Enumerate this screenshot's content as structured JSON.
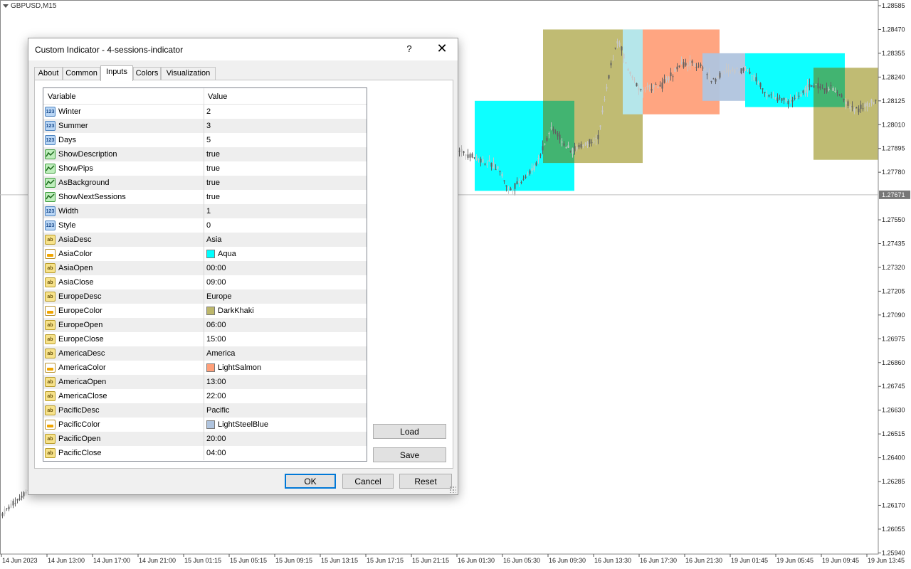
{
  "chart": {
    "title": "GBPUSD,M15",
    "current_price": "1.27671",
    "price_labels": [
      "1.28585",
      "1.28470",
      "1.28355",
      "1.28240",
      "1.28125",
      "1.28010",
      "1.27895",
      "1.27780",
      "1.27671",
      "1.27550",
      "1.27435",
      "1.27320",
      "1.27205",
      "1.27090",
      "1.26975",
      "1.26860",
      "1.26745",
      "1.26630",
      "1.26515",
      "1.26400",
      "1.26285",
      "1.26170",
      "1.26055",
      "1.25940"
    ],
    "time_labels": [
      "14 Jun 2023",
      "14 Jun 13:00",
      "14 Jun 17:00",
      "14 Jun 21:00",
      "15 Jun 01:15",
      "15 Jun 05:15",
      "15 Jun 09:15",
      "15 Jun 13:15",
      "15 Jun 17:15",
      "15 Jun 21:15",
      "16 Jun 01:30",
      "16 Jun 05:30",
      "16 Jun 09:30",
      "16 Jun 13:30",
      "16 Jun 17:30",
      "16 Jun 21:30",
      "19 Jun 01:45",
      "19 Jun 05:45",
      "19 Jun 09:45",
      "19 Jun 13:45"
    ],
    "session_colors": {
      "asia": "#00FFFF",
      "europe": "#BDB76B",
      "america": "#FFA07A",
      "pacific": "#B0C4DE",
      "asia_europe_overlap": "#3CB371",
      "pacific_asia_overlap": "#B4E8F0"
    }
  },
  "dialog": {
    "title": "Custom Indicator - 4-sessions-indicator",
    "help_label": "?",
    "close_label": "✕",
    "tabs": [
      {
        "label": "About",
        "active": false
      },
      {
        "label": "Common",
        "active": false
      },
      {
        "label": "Inputs",
        "active": true
      },
      {
        "label": "Colors",
        "active": false
      },
      {
        "label": "Visualization",
        "active": false
      }
    ],
    "grid": {
      "col_variable": "Variable",
      "col_value": "Value",
      "rows": [
        {
          "type": "int",
          "name": "Winter",
          "value": "2"
        },
        {
          "type": "int",
          "name": "Summer",
          "value": "3"
        },
        {
          "type": "int",
          "name": "Days",
          "value": "5"
        },
        {
          "type": "bool",
          "name": "ShowDescription",
          "value": "true"
        },
        {
          "type": "bool",
          "name": "ShowPips",
          "value": "true"
        },
        {
          "type": "bool",
          "name": "AsBackground",
          "value": "true"
        },
        {
          "type": "bool",
          "name": "ShowNextSessions",
          "value": "true"
        },
        {
          "type": "int",
          "name": "Width",
          "value": "1"
        },
        {
          "type": "int",
          "name": "Style",
          "value": "0"
        },
        {
          "type": "str",
          "name": "AsiaDesc",
          "value": "Asia"
        },
        {
          "type": "color",
          "name": "AsiaColor",
          "value": "Aqua",
          "swatch": "#00FFFF"
        },
        {
          "type": "str",
          "name": "AsiaOpen",
          "value": "00:00"
        },
        {
          "type": "str",
          "name": "AsiaClose",
          "value": "09:00"
        },
        {
          "type": "str",
          "name": "EuropeDesc",
          "value": "Europe"
        },
        {
          "type": "color",
          "name": "EuropeColor",
          "value": "DarkKhaki",
          "swatch": "#BDB76B"
        },
        {
          "type": "str",
          "name": "EuropeOpen",
          "value": "06:00"
        },
        {
          "type": "str",
          "name": "EuropeClose",
          "value": "15:00"
        },
        {
          "type": "str",
          "name": "AmericaDesc",
          "value": "America"
        },
        {
          "type": "color",
          "name": "AmericaColor",
          "value": "LightSalmon",
          "swatch": "#FFA07A"
        },
        {
          "type": "str",
          "name": "AmericaOpen",
          "value": "13:00"
        },
        {
          "type": "str",
          "name": "AmericaClose",
          "value": "22:00"
        },
        {
          "type": "str",
          "name": "PacificDesc",
          "value": "Pacific"
        },
        {
          "type": "color",
          "name": "PacificColor",
          "value": "LightSteelBlue",
          "swatch": "#B0C4DE"
        },
        {
          "type": "str",
          "name": "PacificOpen",
          "value": "20:00"
        },
        {
          "type": "str",
          "name": "PacificClose",
          "value": "04:00"
        }
      ]
    },
    "buttons": {
      "load": "Load",
      "save": "Save",
      "ok": "OK",
      "cancel": "Cancel",
      "reset": "Reset"
    }
  }
}
